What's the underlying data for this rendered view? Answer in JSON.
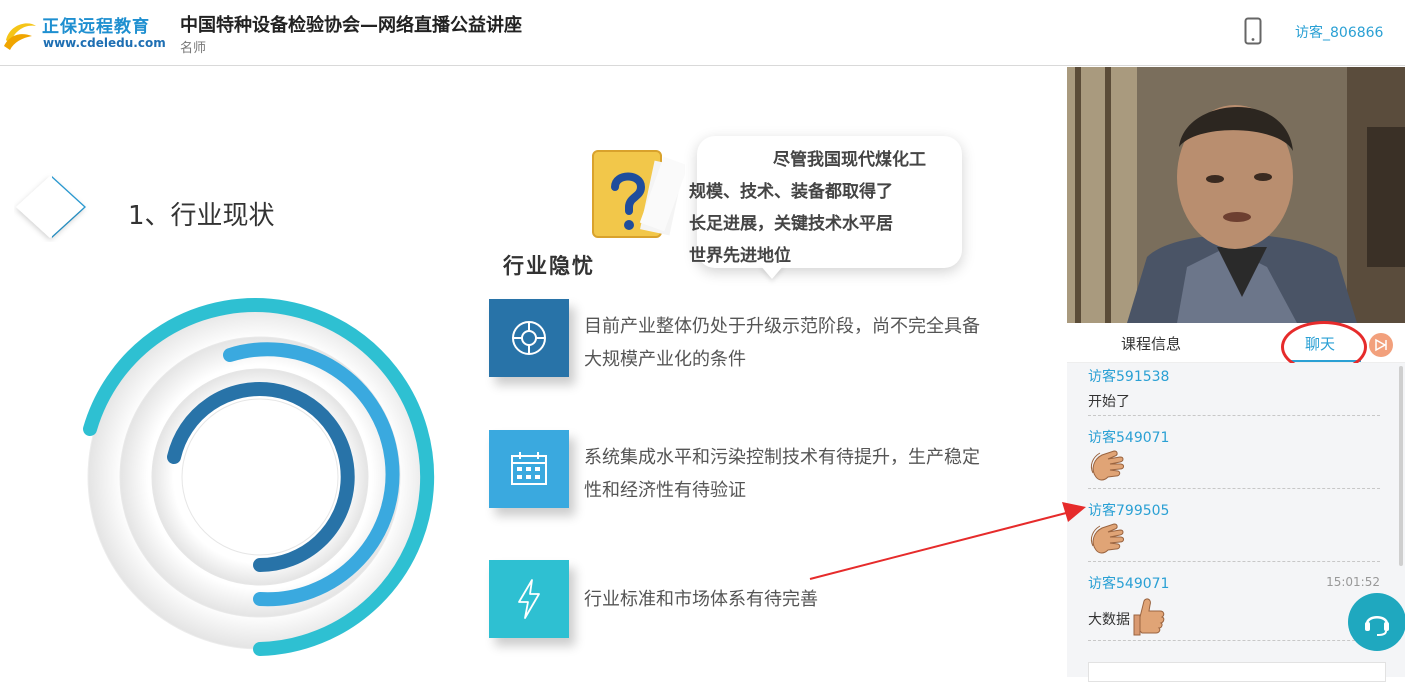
{
  "header": {
    "logo_cn": "正保远程教育",
    "logo_url": "www.cdeledu.com",
    "title": "中国特种设备检验协会—网络直播公益讲座",
    "subtitle": "名师",
    "username": "访客_806866"
  },
  "slide": {
    "heading": "1、行业现状",
    "bubble_lines": [
      "尽管我国现代煤化工",
      "规模、技术、装备都取得了",
      "长足进展，关键技术水平居",
      "世界先进地位"
    ],
    "risk_title": "行业隐忧",
    "items": [
      {
        "text": "目前产业整体仍处于升级示范阶段，尚不完全具备大规模产业化的条件",
        "icon": "lifebuoy-icon",
        "color": "#2873a8"
      },
      {
        "text": "系统集成水平和污染控制技术有待提升，生产稳定性和经济性有待验证",
        "icon": "calendar-icon",
        "color": "#3aa9df"
      },
      {
        "text": "行业标准和市场体系有待完善",
        "icon": "lightning-icon",
        "color": "#2ec0d2"
      }
    ]
  },
  "tabs": {
    "info_label": "课程信息",
    "chat_label": "聊天"
  },
  "chat": {
    "messages": [
      {
        "name": "访客591538",
        "text": "开始了",
        "time": ""
      },
      {
        "name": "访客549071",
        "text": "",
        "time": ""
      },
      {
        "name": "访客799505",
        "text": "",
        "time": ""
      },
      {
        "name": "访客549071",
        "text": "大数据",
        "time": "15:01:52"
      }
    ]
  },
  "colors": {
    "accent": "#2aa0d4",
    "annotation_red": "#e62b2b"
  }
}
